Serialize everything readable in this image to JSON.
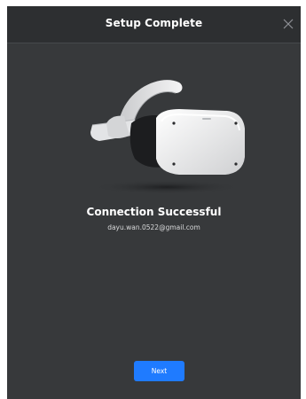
{
  "window": {
    "title": "Setup Complete",
    "close_icon": "close-icon"
  },
  "hero": {
    "image": "vr-headset-illustration"
  },
  "status": {
    "heading": "Connection Successful",
    "email": "dayu.wan.0522@gmail.com"
  },
  "actions": {
    "next_label": "Next"
  },
  "colors": {
    "background": "#37393b",
    "titlebar": "#2d2f31",
    "accent": "#1f7bff",
    "text": "#ffffff"
  }
}
